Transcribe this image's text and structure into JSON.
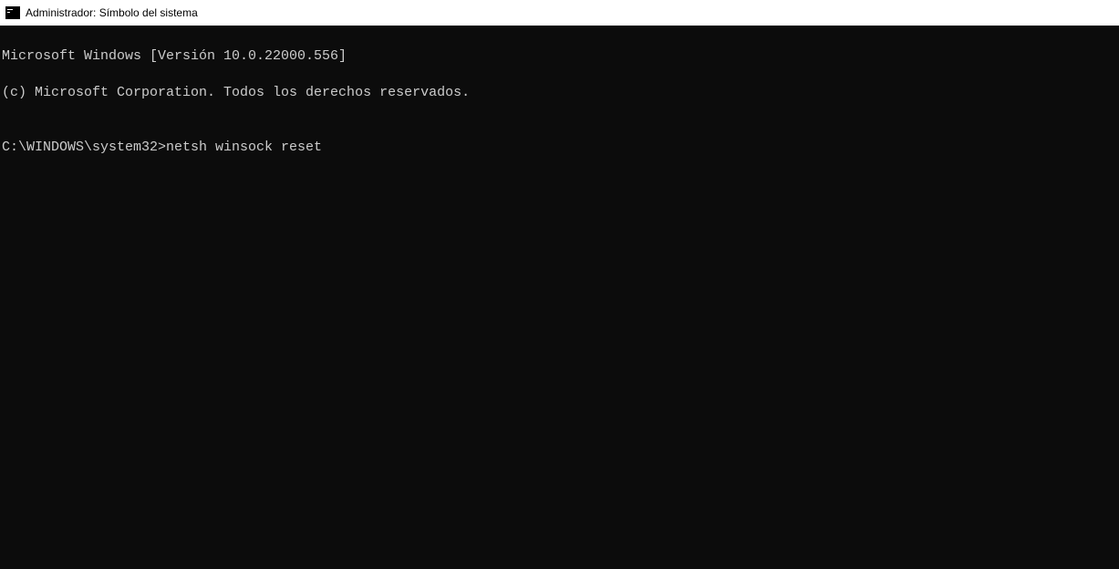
{
  "window": {
    "title": "Administrador: Símbolo del sistema"
  },
  "terminal": {
    "line1": "Microsoft Windows [Versión 10.0.22000.556]",
    "line2": "(c) Microsoft Corporation. Todos los derechos reservados.",
    "blank": "",
    "prompt": "C:\\WINDOWS\\system32>",
    "command": "netsh winsock reset"
  }
}
